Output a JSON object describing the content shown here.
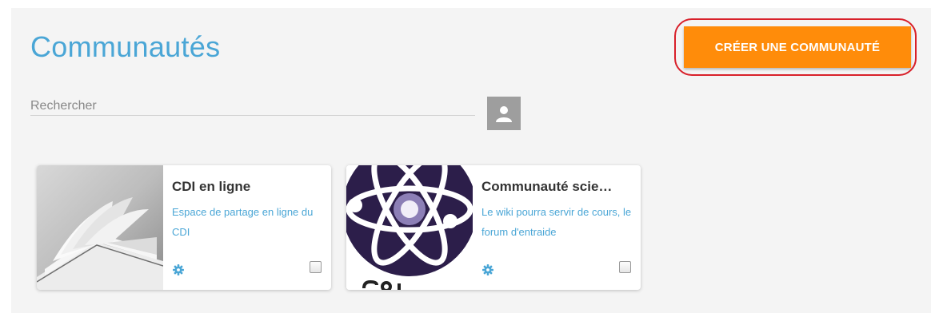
{
  "page": {
    "title": "Communautés"
  },
  "toolbar": {
    "create_label": "CRÉER UNE COMMUNAUTÉ"
  },
  "search": {
    "placeholder": "Rechercher",
    "value": ""
  },
  "colors": {
    "accent": "#4aa6d6",
    "button": "#ff8c0a",
    "highlight": "#d8202a"
  },
  "communities": [
    {
      "title": "CDI en ligne",
      "description": "Espace de partage en ligne du CDI",
      "image_icon": "open-book-icon",
      "checked": false
    },
    {
      "title": "Communauté scie…",
      "description": "Le wiki pourra servir de cours, le forum d'entraide",
      "image_icon": "atom-icon",
      "checked": false
    }
  ]
}
